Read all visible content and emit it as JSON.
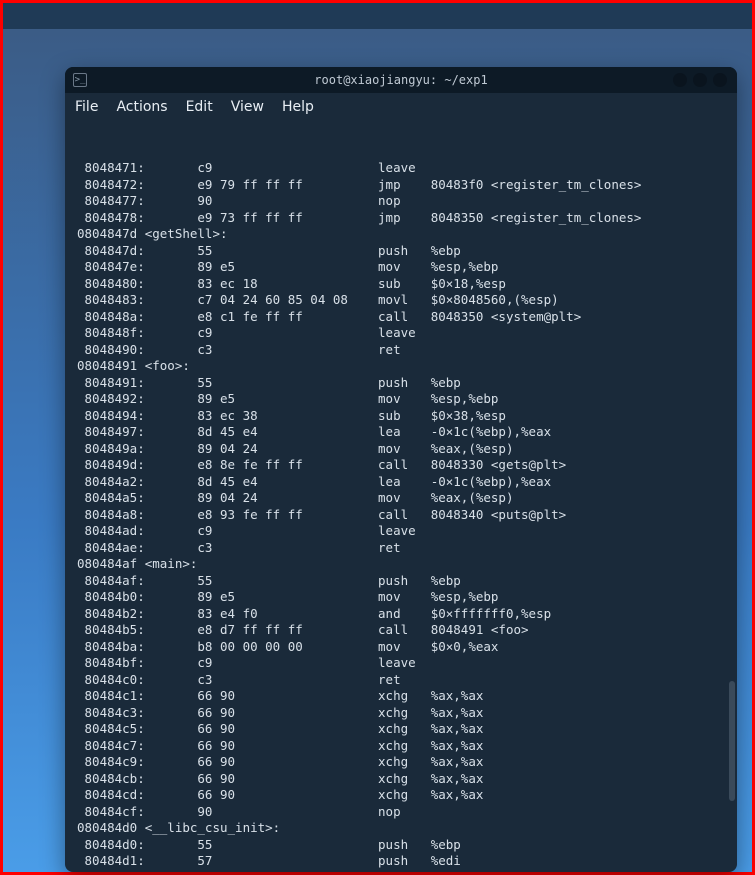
{
  "window": {
    "title": "root@xiaojiangyu: ~/exp1"
  },
  "menubar": {
    "file": "File",
    "actions": "Actions",
    "edit": "Edit",
    "view": "View",
    "help": "Help"
  },
  "disassembly": {
    "lines": [
      " 8048471:       c9                      leave",
      " 8048472:       e9 79 ff ff ff          jmp    80483f0 <register_tm_clones>",
      " 8048477:       90                      nop",
      " 8048478:       e9 73 ff ff ff          jmp    8048350 <register_tm_clones>",
      "",
      "0804847d <getShell>:",
      " 804847d:       55                      push   %ebp",
      " 804847e:       89 e5                   mov    %esp,%ebp",
      " 8048480:       83 ec 18                sub    $0×18,%esp",
      " 8048483:       c7 04 24 60 85 04 08    movl   $0×8048560,(%esp)",
      " 804848a:       e8 c1 fe ff ff          call   8048350 <system@plt>",
      " 804848f:       c9                      leave",
      " 8048490:       c3                      ret",
      "",
      "08048491 <foo>:",
      " 8048491:       55                      push   %ebp",
      " 8048492:       89 e5                   mov    %esp,%ebp",
      " 8048494:       83 ec 38                sub    $0×38,%esp",
      " 8048497:       8d 45 e4                lea    -0×1c(%ebp),%eax",
      " 804849a:       89 04 24                mov    %eax,(%esp)",
      " 804849d:       e8 8e fe ff ff          call   8048330 <gets@plt>",
      " 80484a2:       8d 45 e4                lea    -0×1c(%ebp),%eax",
      " 80484a5:       89 04 24                mov    %eax,(%esp)",
      " 80484a8:       e8 93 fe ff ff          call   8048340 <puts@plt>",
      " 80484ad:       c9                      leave",
      " 80484ae:       c3                      ret",
      "",
      "080484af <main>:",
      " 80484af:       55                      push   %ebp",
      " 80484b0:       89 e5                   mov    %esp,%ebp",
      " 80484b2:       83 e4 f0                and    $0×fffffff0,%esp",
      " 80484b5:       e8 d7 ff ff ff          call   8048491 <foo>",
      " 80484ba:       b8 00 00 00 00          mov    $0×0,%eax",
      " 80484bf:       c9                      leave",
      " 80484c0:       c3                      ret",
      " 80484c1:       66 90                   xchg   %ax,%ax",
      " 80484c3:       66 90                   xchg   %ax,%ax",
      " 80484c5:       66 90                   xchg   %ax,%ax",
      " 80484c7:       66 90                   xchg   %ax,%ax",
      " 80484c9:       66 90                   xchg   %ax,%ax",
      " 80484cb:       66 90                   xchg   %ax,%ax",
      " 80484cd:       66 90                   xchg   %ax,%ax",
      " 80484cf:       90                      nop",
      "",
      "080484d0 <__libc_csu_init>:",
      " 80484d0:       55                      push   %ebp",
      " 80484d1:       57                      push   %edi"
    ]
  }
}
